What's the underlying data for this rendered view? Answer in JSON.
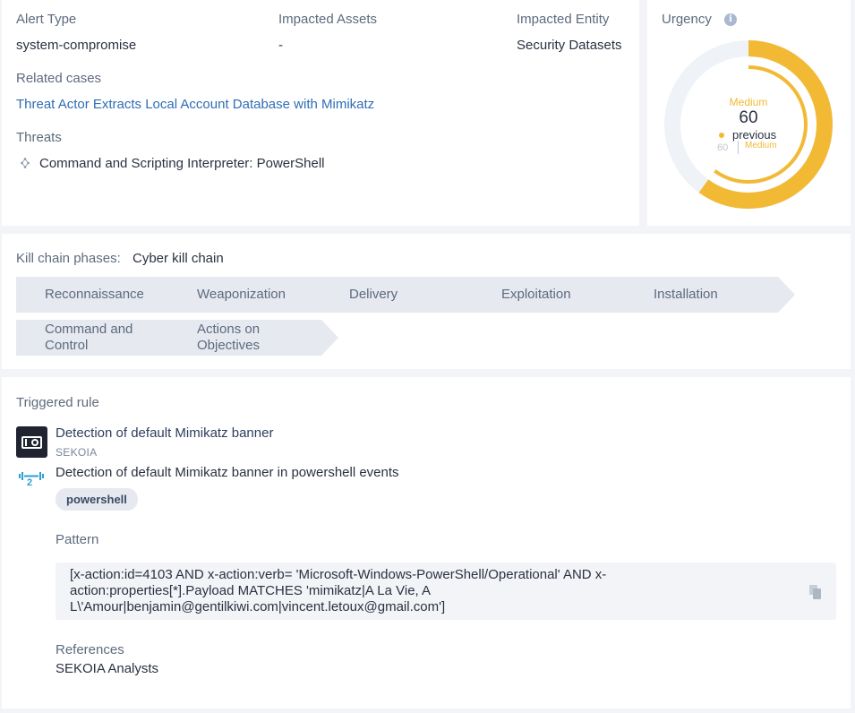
{
  "details": {
    "alert_type_label": "Alert Type",
    "alert_type_value": "system-compromise",
    "impacted_assets_label": "Impacted Assets",
    "impacted_assets_value": "-",
    "impacted_entity_label": "Impacted Entity",
    "impacted_entity_value": "Security Datasets",
    "related_cases_label": "Related cases",
    "related_case_link": "Threat Actor Extracts Local Account Database with Mimikatz",
    "threats_label": "Threats",
    "threat_item": "Command and Scripting Interpreter: PowerShell"
  },
  "urgency": {
    "title": "Urgency",
    "level": "Medium",
    "value": "60",
    "value_fraction": 0.6,
    "previous_label": "previous",
    "previous_value": "60",
    "previous_level": "Medium",
    "accent_color": "#f2b935"
  },
  "kill_chain": {
    "label": "Kill chain phases:",
    "name": "Cyber kill chain",
    "phases": [
      {
        "line1": "Reconnaissance",
        "line2": ""
      },
      {
        "line1": "Weaponization",
        "line2": ""
      },
      {
        "line1": "Delivery",
        "line2": ""
      },
      {
        "line1": "Exploitation",
        "line2": ""
      },
      {
        "line1": "Installation",
        "line2": ""
      },
      {
        "line1": "Command and",
        "line2": "Control"
      },
      {
        "line1": "Actions on",
        "line2": "Objectives"
      }
    ]
  },
  "rule": {
    "section_label": "Triggered rule",
    "name": "Detection of default Mimikatz banner",
    "author": "SEKOIA",
    "effort_level": "2",
    "description": "Detection of default Mimikatz banner in powershell events",
    "tag": "powershell",
    "pattern_label": "Pattern",
    "pattern_line1": "[x-action:id=4103 AND x-action:verb= 'Microsoft-Windows-PowerShell/Operational' AND x-",
    "pattern_line2": "action:properties[*].Payload MATCHES 'mimikatz|A La Vie, A",
    "pattern_line3": "L\\'Amour|benjamin@gentilkiwi.com|vincent.letoux@gmail.com']",
    "references_label": "References",
    "references_value": "SEKOIA Analysts"
  }
}
